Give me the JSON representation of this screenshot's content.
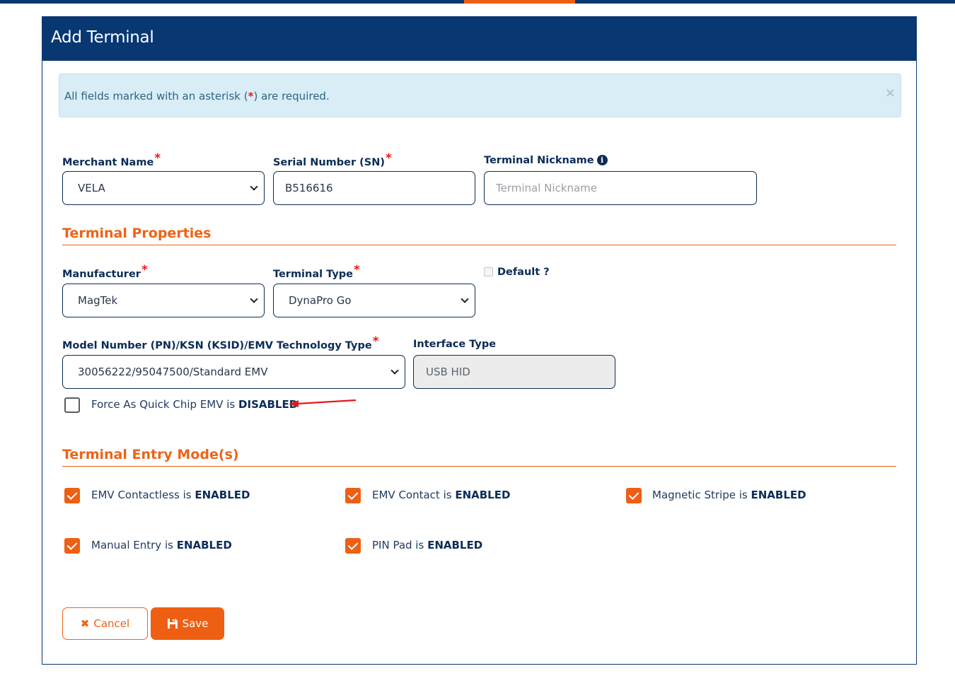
{
  "colors": {
    "brand_navy": "#083772",
    "accent_orange": "#ee5f13",
    "required_red": "#e51b1b",
    "alert_bg": "#d9edf6"
  },
  "dialog": {
    "title": "Add Terminal"
  },
  "alert": {
    "text_before": "All fields marked with an asterisk (",
    "asterisk": "*",
    "text_after": ") are required.",
    "close_icon": "×"
  },
  "fields": {
    "merchant_name": {
      "label": "Merchant Name",
      "required": "*",
      "value": "VELA"
    },
    "serial_number": {
      "label": "Serial Number (SN)",
      "required": "*",
      "value": "B516616"
    },
    "terminal_nickname": {
      "label": "Terminal Nickname",
      "info_icon": "i",
      "placeholder": "Terminal Nickname"
    }
  },
  "terminal_properties": {
    "title": "Terminal Properties",
    "manufacturer": {
      "label": "Manufacturer",
      "required": "*",
      "value": "MagTek"
    },
    "terminal_type": {
      "label": "Terminal Type",
      "required": "*",
      "value": "DynaPro Go"
    },
    "default": {
      "label": "Default ?",
      "checked": false
    },
    "model_number": {
      "label": "Model Number (PN)/KSN (KSID)/EMV Technology Type",
      "required": "*",
      "value": "30056222/95047500/Standard EMV"
    },
    "interface_type": {
      "label": "Interface Type",
      "value": "USB HID"
    },
    "force_quick_chip": {
      "label": "Force As Quick Chip EMV is",
      "status": "DISABLED",
      "checked": false
    }
  },
  "entry_modes": {
    "title": "Terminal Entry Mode(s)",
    "items": [
      {
        "label": "EMV Contactless is",
        "status": "ENABLED",
        "checked": true
      },
      {
        "label": "EMV Contact is",
        "status": "ENABLED",
        "checked": true
      },
      {
        "label": "Magnetic Stripe is",
        "status": "ENABLED",
        "checked": true
      },
      {
        "label": "Manual Entry is",
        "status": "ENABLED",
        "checked": true
      },
      {
        "label": "PIN Pad is",
        "status": "ENABLED",
        "checked": true
      }
    ]
  },
  "actions": {
    "cancel_label": "Cancel",
    "cancel_icon": "✖",
    "save_label": "Save",
    "save_icon": "floppy-disk"
  }
}
